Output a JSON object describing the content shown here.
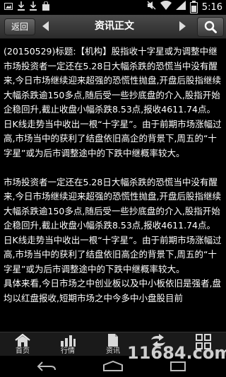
{
  "status_bar": {
    "time": "5:16",
    "icons": [
      "image-icon",
      "download-icon",
      "download-icon",
      "bag-icon",
      "mute-icon",
      "wifi-icon",
      "signal-icon",
      "battery-icon"
    ]
  },
  "header": {
    "back_label": "返回",
    "title": "资讯正文",
    "prev_icon": "arrow-left-icon",
    "next_icon": "arrow-right-icon",
    "search_icon": "search-icon"
  },
  "article": {
    "title": "(20150529)标题:【机构】股指收十字星或为调整中继",
    "paragraphs": [
      "市场投资者一定还在5.28日大幅杀跌的恐慌当中没有醒来,今日市场继续迎来超强的恐慌性抛盘,开盘后股指继续大幅杀跌逾150多点,随后受一些抄底盘的介入,股指开始企稳回升,截止收盘小幅杀跌8.53点,报收4611.74点。日K线走势当中收出一根“十字星”。由于前期市场涨幅过高,市场当中的获利了结盘依旧高企的背景下,周五的“十字星”或为后市调整途中的下跌中继概率较大。",
      "  市场投资者一定还在5.28日大幅杀跌的恐慌当中没有醒来,今日市场继续迎来超强的恐慌性抛盘,开盘后股指继续大幅杀跌逾150多点,随后受一些抄底盘的介入,股指开始企稳回升,截止收盘小幅杀跌8.53点,报收4611.74点。日K线走势当中收出一根“十字星”。由于前期市场涨幅过高,市场当中的获利了结盘依旧高企的背景下,周五的“十字星”或为后市调整途中的下跌中继概率较大。",
      "  具体来看,今日市场之中创业板以及中小板依旧是强者,盘均以红盘报收,短期市场之中今多中小盘股目前"
    ]
  },
  "tabs": [
    {
      "label": "首页",
      "icon": "home-icon"
    },
    {
      "label": "行情",
      "icon": "bar-chart-icon"
    },
    {
      "label": "资讯",
      "icon": "document-icon"
    },
    {
      "label": "",
      "icon": "exchange-icon"
    },
    {
      "label": "",
      "icon": "grid-icon"
    }
  ],
  "nav_bar": {
    "icons": [
      "back-icon",
      "home-icon",
      "recent-apps-icon"
    ]
  },
  "watermark": "11684.com"
}
